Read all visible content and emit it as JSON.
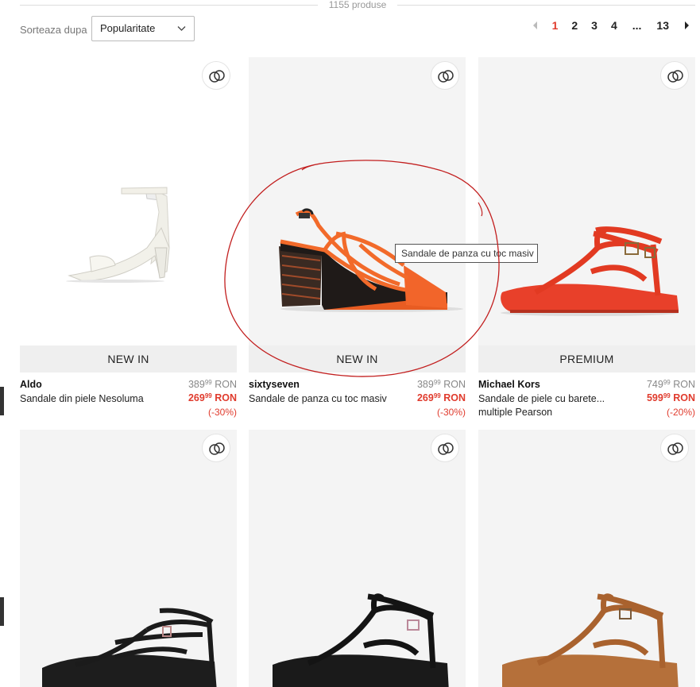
{
  "product_count": "1155 produse",
  "sort": {
    "label": "Sorteaza dupa",
    "value": "Popularitate"
  },
  "pagination": {
    "pages": [
      "1",
      "2",
      "3",
      "4",
      "...",
      "13"
    ],
    "current": "1"
  },
  "tooltip": "Sandale de panza cu toc masiv",
  "colors": {
    "accent": "#e03b2d",
    "annotation": "#c21e1e"
  },
  "products": [
    {
      "brand": "Aldo",
      "name": "Sandale din piele Nesoluma",
      "badge": "NEW IN",
      "old_int": "389",
      "old_dec": "99",
      "old_cur": "RON",
      "new_int": "269",
      "new_dec": "99",
      "new_cur": "RON",
      "discount": "(-30%)"
    },
    {
      "brand": "sixtyseven",
      "name": "Sandale de panza cu toc masiv",
      "badge": "NEW IN",
      "old_int": "389",
      "old_dec": "99",
      "old_cur": "RON",
      "new_int": "269",
      "new_dec": "99",
      "new_cur": "RON",
      "discount": "(-30%)"
    },
    {
      "brand": "Michael Kors",
      "name": "Sandale de piele cu barete...",
      "name2": "multiple Pearson",
      "badge": "PREMIUM",
      "old_int": "749",
      "old_dec": "99",
      "old_cur": "RON",
      "new_int": "599",
      "new_dec": "99",
      "new_cur": "RON",
      "discount": "(-20%)"
    },
    {
      "brand": "",
      "name": ""
    },
    {
      "brand": "",
      "name": ""
    },
    {
      "brand": "",
      "name": ""
    }
  ]
}
